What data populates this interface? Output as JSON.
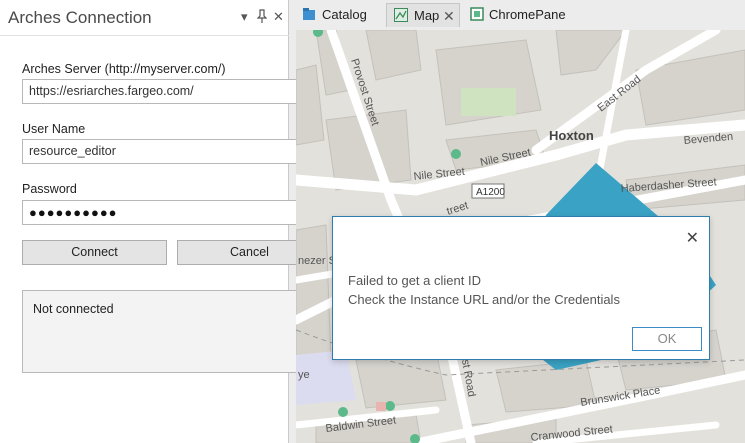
{
  "pane": {
    "title": "Arches Connection",
    "menu_icon": "▾",
    "pin_icon": "↕",
    "close_icon": "✕",
    "server": {
      "label": "Arches Server (http://myserver.com/)",
      "value": "https://esriarches.fargeo.com/"
    },
    "username": {
      "label": "User Name",
      "value": "resource_editor"
    },
    "password": {
      "label": "Password",
      "value": "●●●●●●●●●●"
    },
    "connect_label": "Connect",
    "cancel_label": "Cancel",
    "status": "Not connected"
  },
  "tabs": [
    {
      "label": "Catalog",
      "icon": "catalog-icon"
    },
    {
      "label": "Map",
      "icon": "map-icon",
      "close": "✕"
    },
    {
      "label": "ChromePane",
      "icon": "chrome-pane-icon"
    }
  ],
  "map": {
    "labels": {
      "provost": "Provost Street",
      "east_road": "East Road",
      "hoxton": "Hoxton",
      "bevenden": "Bevenden",
      "nile1": "Nile Street",
      "nile2": "Nile Street",
      "a1200": "A1200",
      "haberdasher": "Haberdasher Street",
      "street_frag": "treet",
      "nezer": "nezer St",
      "ye": "ye",
      "st_frag": "st Road",
      "brunswick": "Brunswick Place",
      "baldwin": "Baldwin Street",
      "cranwood": "Cranwood Street"
    },
    "colors": {
      "polygon": "#3aa2c4",
      "green": "#5bb98a",
      "park": "#d0e3c0"
    }
  },
  "dialog": {
    "close_icon": "✕",
    "line1": "Failed to get a client ID",
    "line2": "Check the Instance URL and/or the Credentials",
    "ok_label": "OK"
  }
}
